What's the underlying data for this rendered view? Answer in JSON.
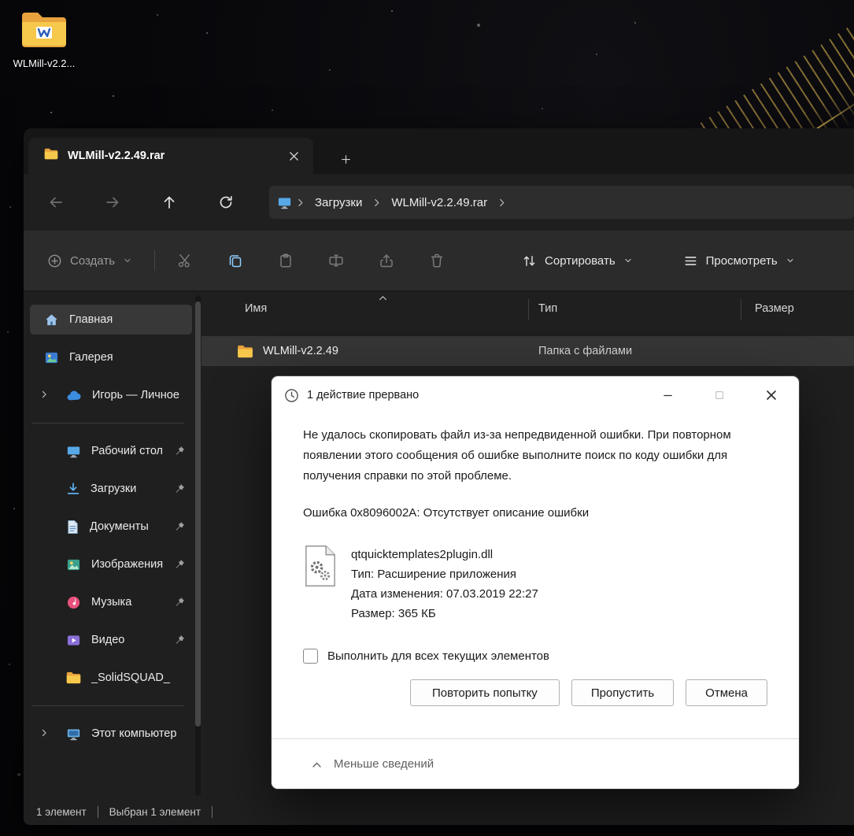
{
  "desktop": {
    "icon_label": "WLMill-v2.2..."
  },
  "explorer": {
    "tab_title": "WLMill-v2.2.49.rar",
    "breadcrumb": {
      "crumb1": "Загрузки",
      "crumb2": "WLMill-v2.2.49.rar"
    },
    "toolbar": {
      "create": "Создать",
      "sort": "Сортировать",
      "view": "Просмотреть"
    },
    "sidebar": {
      "items": [
        {
          "label": "Главная"
        },
        {
          "label": "Галерея"
        },
        {
          "label": "Игорь — Личное"
        },
        {
          "label": "Рабочий стол"
        },
        {
          "label": "Загрузки"
        },
        {
          "label": "Документы"
        },
        {
          "label": "Изображения"
        },
        {
          "label": "Музыка"
        },
        {
          "label": "Видео"
        },
        {
          "label": "_SolidSQUAD_"
        },
        {
          "label": "Этот компьютер"
        }
      ]
    },
    "filelist": {
      "col_name": "Имя",
      "col_type": "Тип",
      "col_size": "Размер",
      "row": {
        "name": "WLMill-v2.2.49",
        "type": "Папка с файлами"
      }
    },
    "status": {
      "count": "1 элемент",
      "selected": "Выбран 1 элемент"
    }
  },
  "dialog": {
    "title": "1 действие прервано",
    "message": "Не удалось скопировать файл из-за непредвиденной ошибки. При повторном появлении этого сообщения об ошибке выполните поиск по коду ошибки для получения справки по этой проблеме.",
    "error_line": "Ошибка 0x8096002A: Отсутствует описание ошибки",
    "file": {
      "name": "qtquicktemplates2plugin.dll",
      "type": "Тип: Расширение приложения",
      "modified": "Дата изменения: 07.03.2019 22:27",
      "size": "Размер: 365 КБ"
    },
    "checkbox_label": "Выполнить для всех текущих элементов",
    "buttons": {
      "retry": "Повторить попытку",
      "skip": "Пропустить",
      "cancel": "Отмена"
    },
    "details": "Меньше сведений"
  }
}
